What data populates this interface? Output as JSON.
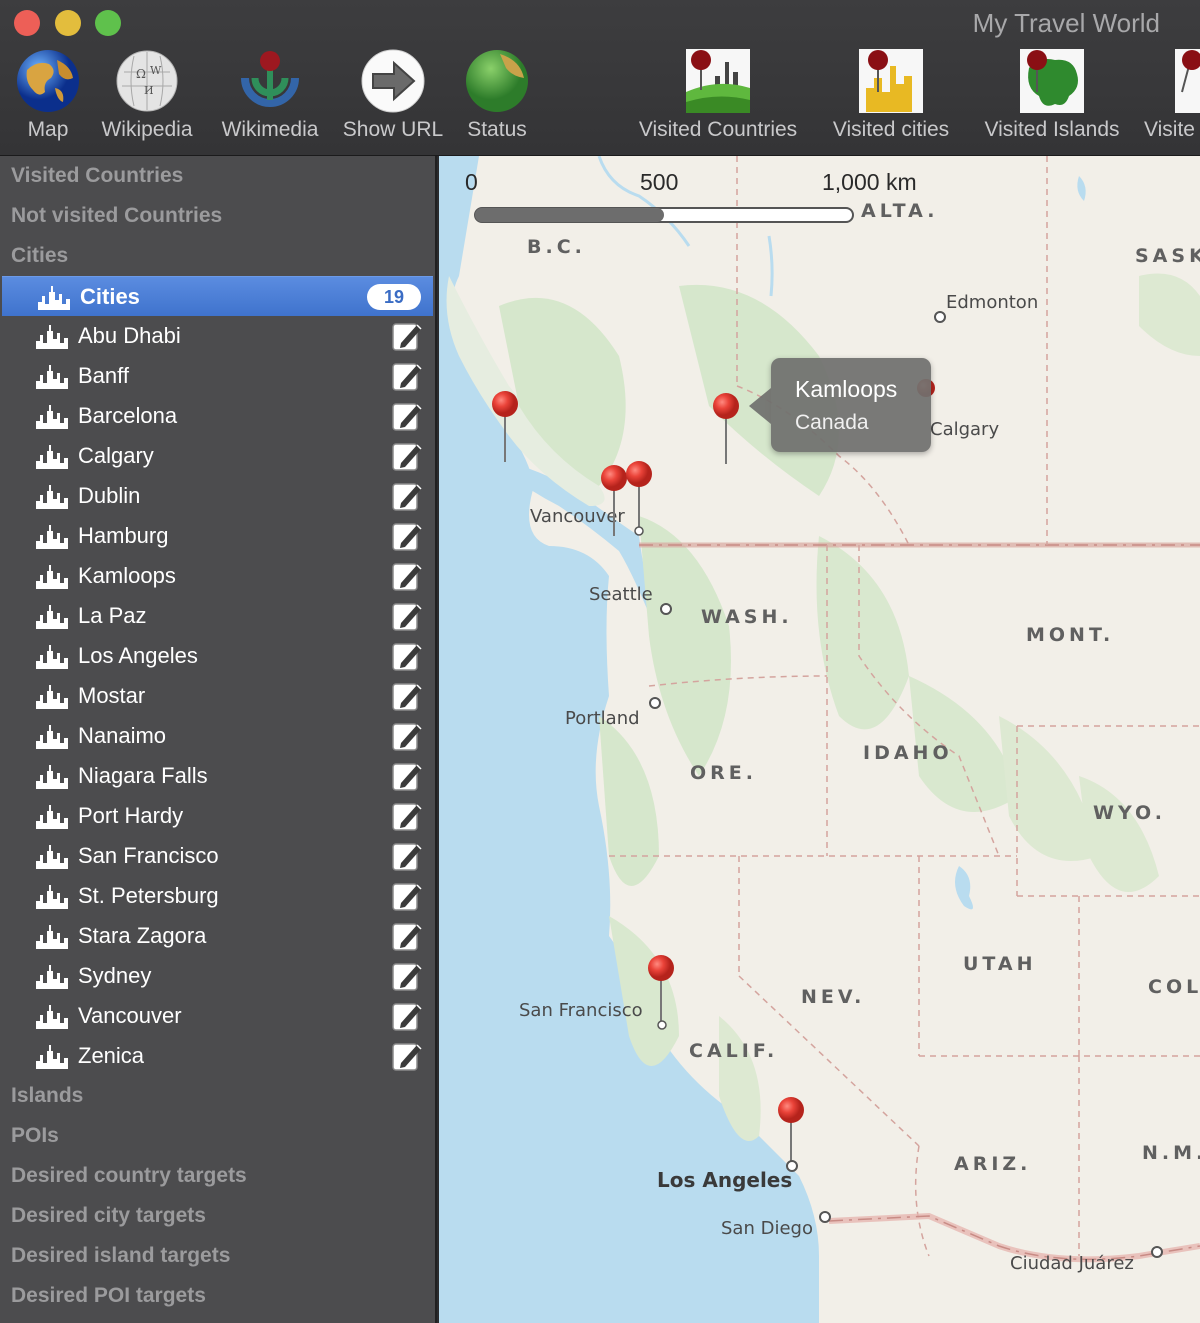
{
  "window": {
    "title": "My Travel World"
  },
  "toolbar": {
    "items": [
      {
        "label": "Map",
        "icon": "globe-icon"
      },
      {
        "label": "Wikipedia",
        "icon": "wikipedia-globe-icon"
      },
      {
        "label": "Wikimedia",
        "icon": "wikimedia-logo-icon"
      },
      {
        "label": "Show URL",
        "icon": "arrow-right-icon"
      },
      {
        "label": "Status",
        "icon": "status-globe-icon"
      },
      {
        "label": "Visited Countries",
        "icon": "visited-countries-icon"
      },
      {
        "label": "Visited cities",
        "icon": "visited-cities-icon"
      },
      {
        "label": "Visited Islands",
        "icon": "visited-islands-icon"
      },
      {
        "label": "Visite",
        "icon": "visited-more-icon"
      }
    ]
  },
  "sidebar": {
    "groups_top": [
      "Visited Countries",
      "Not visited Countries",
      "Cities"
    ],
    "selected": {
      "label": "Cities",
      "count": "19"
    },
    "cities": [
      "Abu Dhabi",
      "Banff",
      "Barcelona",
      "Calgary",
      "Dublin",
      "Hamburg",
      "Kamloops",
      "La Paz",
      "Los Angeles",
      "Mostar",
      "Nanaimo",
      "Niagara Falls",
      "Port Hardy",
      "San Francisco",
      "St. Petersburg",
      "Stara Zagora",
      "Sydney",
      "Vancouver",
      "Zenica"
    ],
    "groups_bottom": [
      "Islands",
      "POIs",
      "Desired country targets",
      "Desired city targets",
      "Desired island targets",
      "Desired POI targets"
    ]
  },
  "map": {
    "scale": {
      "zero": "0",
      "mid": "500",
      "end": "1,000 km"
    },
    "states": [
      "ALTA.",
      "B.C.",
      "SASK",
      "WASH.",
      "MONT.",
      "IDAHO",
      "ORE.",
      "WYO.",
      "UTAH",
      "NEV.",
      "COL",
      "CALIF.",
      "ARIZ.",
      "N.M."
    ],
    "cities": [
      "Edmonton",
      "Calgary",
      "Vancouver",
      "Seattle",
      "Portland",
      "San Francisco",
      "Los Angeles",
      "San Diego",
      "Ciudad Juárez"
    ],
    "callout": {
      "title": "Kamloops",
      "subtitle": "Canada"
    },
    "colors": {
      "water": "#b9dcef",
      "land": "#f2efe8",
      "forest": "#d9e8cf",
      "pin": "#e8413a"
    }
  }
}
